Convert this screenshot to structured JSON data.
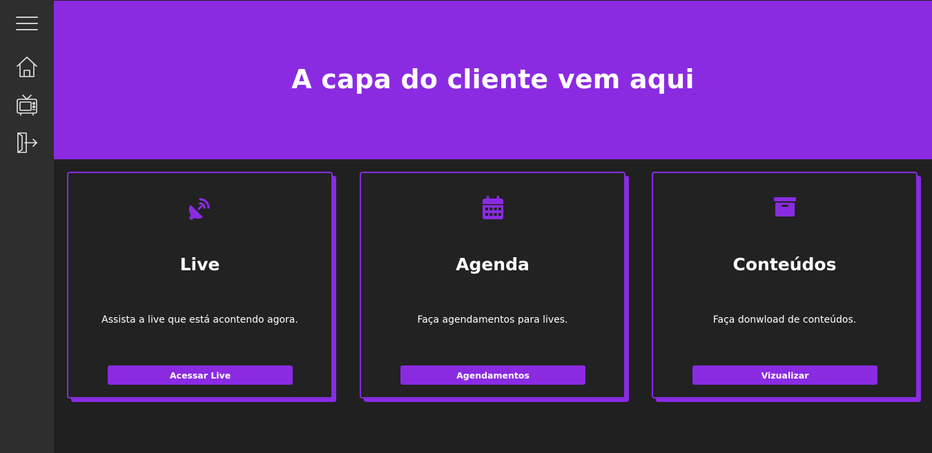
{
  "sidebar": {
    "items": [
      {
        "icon": "hamburger-menu-icon"
      },
      {
        "icon": "home-icon"
      },
      {
        "icon": "tv-icon"
      },
      {
        "icon": "logout-icon"
      }
    ],
    "icon_color": "#e6e6e6"
  },
  "hero": {
    "title": "A capa do cliente vem aqui",
    "background": "#8a2be2"
  },
  "cards": [
    {
      "icon": "satellite-dish-icon",
      "title": "Live",
      "description": "Assista a live que está acontendo agora.",
      "button_label": "Acessar Live"
    },
    {
      "icon": "calendar-icon",
      "title": "Agenda",
      "description": "Faça agendamentos para lives.",
      "button_label": "Agendamentos"
    },
    {
      "icon": "archive-box-icon",
      "title": "Conteúdos",
      "description": "Faça donwload de conteúdos.",
      "button_label": "Vizualizar"
    }
  ],
  "colors": {
    "accent": "#8a2be2",
    "background": "#202020",
    "sidebar": "#2e2e2e",
    "card_background": "#222222",
    "text": "#ffffff"
  }
}
